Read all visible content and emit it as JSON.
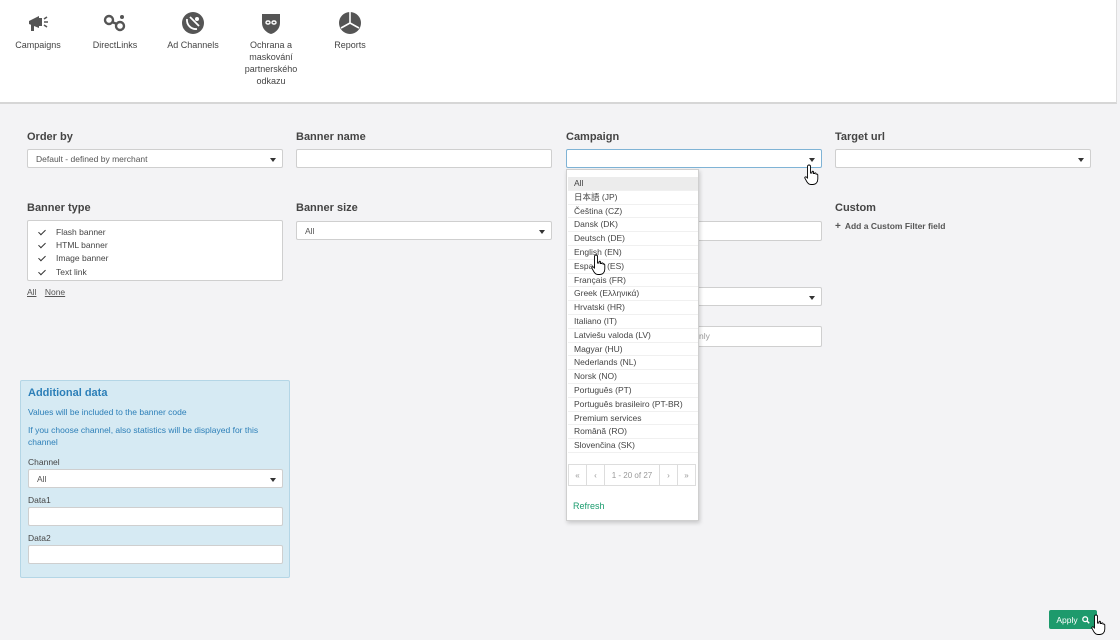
{
  "nav": {
    "items": [
      {
        "label": "Campaigns",
        "icon": "megaphone-icon"
      },
      {
        "label": "DirectLinks",
        "icon": "link-icon"
      },
      {
        "label": "Ad Channels",
        "icon": "satellite-icon"
      },
      {
        "label": "Ochrana a maskování partnerského odkazu",
        "icon": "mask-icon"
      },
      {
        "label": "Reports",
        "icon": "pie-chart-icon"
      }
    ]
  },
  "filters": {
    "order_by": {
      "label": "Order by",
      "value": "Default - defined by merchant"
    },
    "banner_name": {
      "label": "Banner name",
      "value": ""
    },
    "campaign": {
      "label": "Campaign",
      "value": ""
    },
    "target_url": {
      "label": "Target url",
      "value": ""
    },
    "banner_type": {
      "label": "Banner type",
      "options": [
        "Flash banner",
        "HTML banner",
        "Image banner",
        "Text link"
      ],
      "all_link": "All",
      "none_link": "None"
    },
    "banner_size": {
      "label": "Banner size",
      "value": "All"
    },
    "custom": {
      "label": "Custom",
      "add_label": "Add a Custom Filter field"
    },
    "hidden_input_tail": "nly"
  },
  "additional_data": {
    "title": "Additional data",
    "text1": "Values will be included to the banner code",
    "text2": "If you choose channel, also statistics will be displayed for this channel",
    "channel_label": "Channel",
    "channel_value": "All",
    "data1_label": "Data1",
    "data2_label": "Data2"
  },
  "campaign_dropdown": {
    "items": [
      "All",
      "日本語 (JP)",
      "Čeština (CZ)",
      "Dansk (DK)",
      "Deutsch (DE)",
      "English (EN)",
      "Español (ES)",
      "Français (FR)",
      "Greek (Ελληνικά)",
      "Hrvatski (HR)",
      "Italiano (IT)",
      "Latviešu valoda (LV)",
      "Magyar (HU)",
      "Nederlands (NL)",
      "Norsk (NO)",
      "Português (PT)",
      "Português brasileiro (PT-BR)",
      "Premium services",
      "Română (RO)",
      "Slovenčina (SK)"
    ],
    "pager": {
      "first": "«",
      "prev": "‹",
      "info": "1 - 20 of 27",
      "next": "›",
      "last": "»"
    },
    "refresh": "Refresh"
  },
  "apply_button": "Apply",
  "colors": {
    "accent": "#1d9a6c",
    "panel_bg": "#d6eaf3",
    "panel_text": "#2c7fb8"
  }
}
